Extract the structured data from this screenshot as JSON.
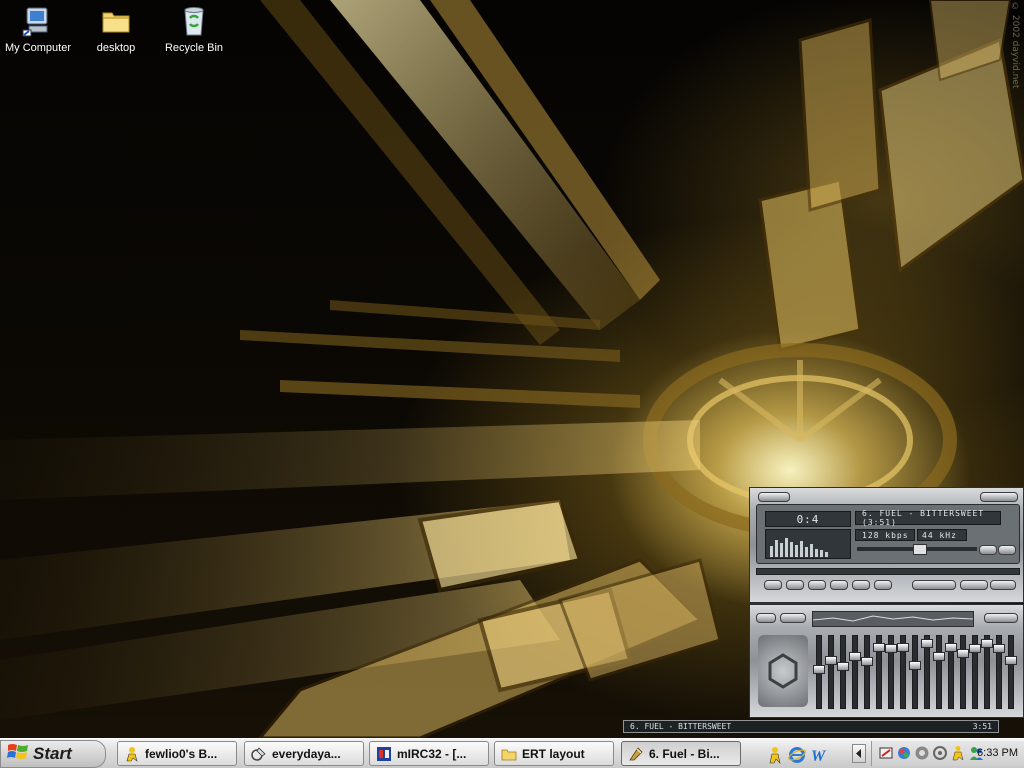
{
  "desktop": {
    "icons": [
      {
        "label": "My Computer",
        "icon": "my-computer-icon"
      },
      {
        "label": "desktop",
        "icon": "folder-icon"
      },
      {
        "label": "Recycle Bin",
        "icon": "recycle-bin-icon"
      }
    ],
    "watermark": "© 2002 dayvid.net"
  },
  "winamp": {
    "time": "0:4",
    "track_title": "6. FUEL - BITTERSWEET (3:51)",
    "bitrate": "128 kbps",
    "samplerate": "44 kHz",
    "eq_levels": [
      0.45,
      0.3,
      0.4,
      0.25,
      0.32,
      0.1,
      0.12,
      0.1,
      0.38,
      0.05,
      0.25,
      0.1,
      0.2,
      0.12,
      0.05,
      0.12,
      0.3
    ],
    "ticker_title": "6. FUEL - BITTERSWEET",
    "ticker_time": "3:51"
  },
  "taskbar": {
    "start_label": "Start",
    "tasks": [
      {
        "label": "fewlio0's B...",
        "icon": "aim-buddy-icon",
        "active": false
      },
      {
        "label": "everydaya...",
        "icon": "pen-icon",
        "active": false
      },
      {
        "label": "mIRC32 - [...",
        "icon": "mirc-icon",
        "active": false
      },
      {
        "label": "ERT layout",
        "icon": "folder-icon",
        "active": false
      },
      {
        "label": "6. Fuel - Bi...",
        "icon": "winamp-icon",
        "active": true
      }
    ],
    "quick_launch": [
      "aim-icon",
      "internet-explorer-icon",
      "winamp-w-icon"
    ],
    "tray_icons": [
      "volume-icon",
      "network-icon",
      "firefox-icon",
      "sound-icon",
      "aim-tray-icon",
      "messenger-icon"
    ],
    "clock": "6:33 PM"
  },
  "colors": {
    "taskbar": "#d6d6d6",
    "winamp_silver": "#a9acb0",
    "winamp_lcd": "#30363a",
    "wallpaper_gold": "#e8c060"
  }
}
